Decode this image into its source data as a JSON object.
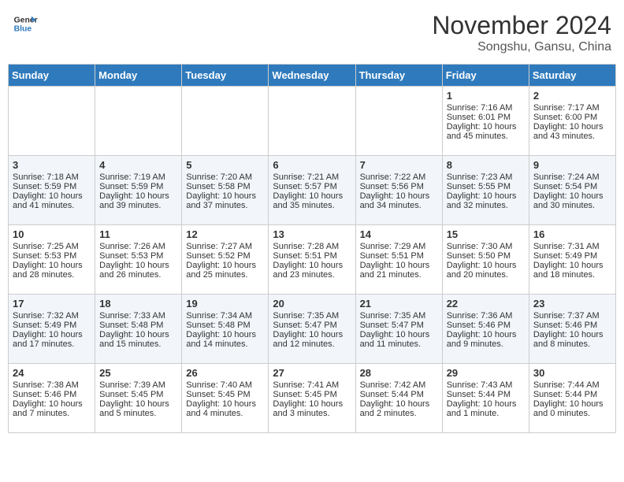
{
  "header": {
    "logo_line1": "General",
    "logo_line2": "Blue",
    "month": "November 2024",
    "location": "Songshu, Gansu, China"
  },
  "days_of_week": [
    "Sunday",
    "Monday",
    "Tuesday",
    "Wednesday",
    "Thursday",
    "Friday",
    "Saturday"
  ],
  "weeks": [
    [
      {
        "day": "",
        "info": ""
      },
      {
        "day": "",
        "info": ""
      },
      {
        "day": "",
        "info": ""
      },
      {
        "day": "",
        "info": ""
      },
      {
        "day": "",
        "info": ""
      },
      {
        "day": "1",
        "info": "Sunrise: 7:16 AM\nSunset: 6:01 PM\nDaylight: 10 hours and 45 minutes."
      },
      {
        "day": "2",
        "info": "Sunrise: 7:17 AM\nSunset: 6:00 PM\nDaylight: 10 hours and 43 minutes."
      }
    ],
    [
      {
        "day": "3",
        "info": "Sunrise: 7:18 AM\nSunset: 5:59 PM\nDaylight: 10 hours and 41 minutes."
      },
      {
        "day": "4",
        "info": "Sunrise: 7:19 AM\nSunset: 5:59 PM\nDaylight: 10 hours and 39 minutes."
      },
      {
        "day": "5",
        "info": "Sunrise: 7:20 AM\nSunset: 5:58 PM\nDaylight: 10 hours and 37 minutes."
      },
      {
        "day": "6",
        "info": "Sunrise: 7:21 AM\nSunset: 5:57 PM\nDaylight: 10 hours and 35 minutes."
      },
      {
        "day": "7",
        "info": "Sunrise: 7:22 AM\nSunset: 5:56 PM\nDaylight: 10 hours and 34 minutes."
      },
      {
        "day": "8",
        "info": "Sunrise: 7:23 AM\nSunset: 5:55 PM\nDaylight: 10 hours and 32 minutes."
      },
      {
        "day": "9",
        "info": "Sunrise: 7:24 AM\nSunset: 5:54 PM\nDaylight: 10 hours and 30 minutes."
      }
    ],
    [
      {
        "day": "10",
        "info": "Sunrise: 7:25 AM\nSunset: 5:53 PM\nDaylight: 10 hours and 28 minutes."
      },
      {
        "day": "11",
        "info": "Sunrise: 7:26 AM\nSunset: 5:53 PM\nDaylight: 10 hours and 26 minutes."
      },
      {
        "day": "12",
        "info": "Sunrise: 7:27 AM\nSunset: 5:52 PM\nDaylight: 10 hours and 25 minutes."
      },
      {
        "day": "13",
        "info": "Sunrise: 7:28 AM\nSunset: 5:51 PM\nDaylight: 10 hours and 23 minutes."
      },
      {
        "day": "14",
        "info": "Sunrise: 7:29 AM\nSunset: 5:51 PM\nDaylight: 10 hours and 21 minutes."
      },
      {
        "day": "15",
        "info": "Sunrise: 7:30 AM\nSunset: 5:50 PM\nDaylight: 10 hours and 20 minutes."
      },
      {
        "day": "16",
        "info": "Sunrise: 7:31 AM\nSunset: 5:49 PM\nDaylight: 10 hours and 18 minutes."
      }
    ],
    [
      {
        "day": "17",
        "info": "Sunrise: 7:32 AM\nSunset: 5:49 PM\nDaylight: 10 hours and 17 minutes."
      },
      {
        "day": "18",
        "info": "Sunrise: 7:33 AM\nSunset: 5:48 PM\nDaylight: 10 hours and 15 minutes."
      },
      {
        "day": "19",
        "info": "Sunrise: 7:34 AM\nSunset: 5:48 PM\nDaylight: 10 hours and 14 minutes."
      },
      {
        "day": "20",
        "info": "Sunrise: 7:35 AM\nSunset: 5:47 PM\nDaylight: 10 hours and 12 minutes."
      },
      {
        "day": "21",
        "info": "Sunrise: 7:35 AM\nSunset: 5:47 PM\nDaylight: 10 hours and 11 minutes."
      },
      {
        "day": "22",
        "info": "Sunrise: 7:36 AM\nSunset: 5:46 PM\nDaylight: 10 hours and 9 minutes."
      },
      {
        "day": "23",
        "info": "Sunrise: 7:37 AM\nSunset: 5:46 PM\nDaylight: 10 hours and 8 minutes."
      }
    ],
    [
      {
        "day": "24",
        "info": "Sunrise: 7:38 AM\nSunset: 5:46 PM\nDaylight: 10 hours and 7 minutes."
      },
      {
        "day": "25",
        "info": "Sunrise: 7:39 AM\nSunset: 5:45 PM\nDaylight: 10 hours and 5 minutes."
      },
      {
        "day": "26",
        "info": "Sunrise: 7:40 AM\nSunset: 5:45 PM\nDaylight: 10 hours and 4 minutes."
      },
      {
        "day": "27",
        "info": "Sunrise: 7:41 AM\nSunset: 5:45 PM\nDaylight: 10 hours and 3 minutes."
      },
      {
        "day": "28",
        "info": "Sunrise: 7:42 AM\nSunset: 5:44 PM\nDaylight: 10 hours and 2 minutes."
      },
      {
        "day": "29",
        "info": "Sunrise: 7:43 AM\nSunset: 5:44 PM\nDaylight: 10 hours and 1 minute."
      },
      {
        "day": "30",
        "info": "Sunrise: 7:44 AM\nSunset: 5:44 PM\nDaylight: 10 hours and 0 minutes."
      }
    ]
  ]
}
